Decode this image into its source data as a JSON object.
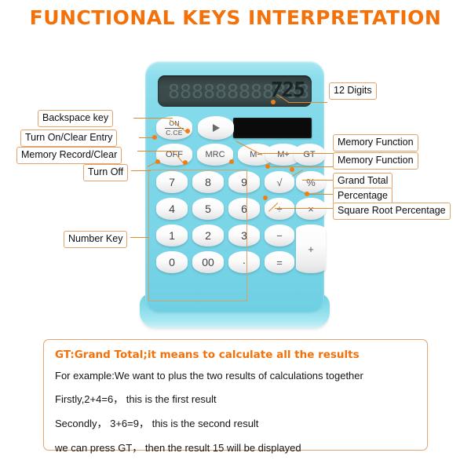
{
  "page": {
    "title": "FUNCTIONAL KEYS INTERPRETATION",
    "title_color": "#F4710A",
    "background": "#FFFFFF"
  },
  "calculator": {
    "body_color": "#7FD8E9",
    "display": {
      "value": "725",
      "ghost_digits": [
        "8",
        "8",
        "8",
        "8",
        "8",
        "8",
        "8",
        "8",
        "8",
        "8",
        "8",
        "8"
      ],
      "digit_count": 12
    },
    "solar_panel": {
      "name": "solar-panel",
      "color": "#0B0B0C"
    },
    "function_keys": [
      {
        "id": "on-ce",
        "line1": "ON",
        "line2": "C.CE"
      },
      {
        "id": "backspace",
        "label": "▶"
      },
      {
        "id": "off",
        "label": "OFF"
      },
      {
        "id": "mrc",
        "label": "MRC"
      },
      {
        "id": "m-minus",
        "label": "M−"
      },
      {
        "id": "m-plus",
        "label": "M+"
      },
      {
        "id": "gt",
        "label": "GT"
      }
    ],
    "number_keys": [
      {
        "id": "7",
        "label": "7"
      },
      {
        "id": "8",
        "label": "8"
      },
      {
        "id": "9",
        "label": "9"
      },
      {
        "id": "4",
        "label": "4"
      },
      {
        "id": "5",
        "label": "5"
      },
      {
        "id": "6",
        "label": "6"
      },
      {
        "id": "1",
        "label": "1"
      },
      {
        "id": "2",
        "label": "2"
      },
      {
        "id": "3",
        "label": "3"
      },
      {
        "id": "0",
        "label": "0"
      },
      {
        "id": "00",
        "label": "00"
      },
      {
        "id": "decimal",
        "label": "·"
      }
    ],
    "operator_keys": [
      {
        "id": "sqrt",
        "label": "√"
      },
      {
        "id": "percent",
        "label": "%"
      },
      {
        "id": "divide",
        "label": "÷"
      },
      {
        "id": "multiply",
        "label": "×"
      },
      {
        "id": "minus",
        "label": "−"
      },
      {
        "id": "equals",
        "label": "="
      },
      {
        "id": "plus",
        "label": "+"
      }
    ]
  },
  "annotations": {
    "accent_color": "#F07F13",
    "box_border_color": "#E8A46E",
    "left": [
      {
        "id": "backspace-key",
        "text": "Backspace key"
      },
      {
        "id": "turn-on-clear-entry",
        "text": "Turn On/Clear Entry"
      },
      {
        "id": "memory-record-clear",
        "text": "Memory Record/Clear"
      },
      {
        "id": "turn-off",
        "text": "Turn Off"
      },
      {
        "id": "number-key",
        "text": "Number Key"
      }
    ],
    "right": [
      {
        "id": "twelve-digits",
        "text": "12 Digits"
      },
      {
        "id": "memory-function-1",
        "text": "Memory Function"
      },
      {
        "id": "memory-function-2",
        "text": "Memory Function"
      },
      {
        "id": "grand-total",
        "text": "Grand Total"
      },
      {
        "id": "percentage",
        "text": "Percentage"
      },
      {
        "id": "square-root-percentage",
        "text": "Square Root Percentage"
      }
    ]
  },
  "note": {
    "heading": "GT:Grand Total;it means to calculate all the results",
    "lines": [
      "For example:We want to plus the two  results of calculations together",
      "Firstly,2+4=6， this is the first result",
      "Secondly， 3+6=9， this is the second result",
      "we can press GT， then the result 15 will be displayed"
    ]
  }
}
